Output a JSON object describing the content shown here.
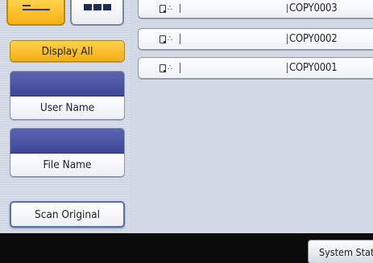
{
  "left_panel": {
    "view_list_icon": "list-view-icon",
    "view_thumb_icon": "thumbnail-view-icon",
    "display_all_label": "Display All",
    "user_name_label": "User Name",
    "user_name_value": "",
    "file_name_label": "File Name",
    "file_name_value": "",
    "scan_original_label": "Scan Original"
  },
  "file_list": {
    "rows": [
      {
        "name": "COPY0003",
        "icons": [
          "document-icon",
          "users-icon"
        ]
      },
      {
        "name": "COPY0002",
        "icons": [
          "document-icon",
          "users-icon"
        ]
      },
      {
        "name": "COPY0001",
        "icons": [
          "document-icon",
          "users-icon"
        ]
      }
    ]
  },
  "bottom_bar": {
    "system_status_label": "System Status"
  },
  "colors": {
    "accent_yellow": "#f7b018",
    "field_blue": "#4a53a4",
    "background": "#cfd7e3",
    "bottom_bar": "#0b0b0b"
  }
}
